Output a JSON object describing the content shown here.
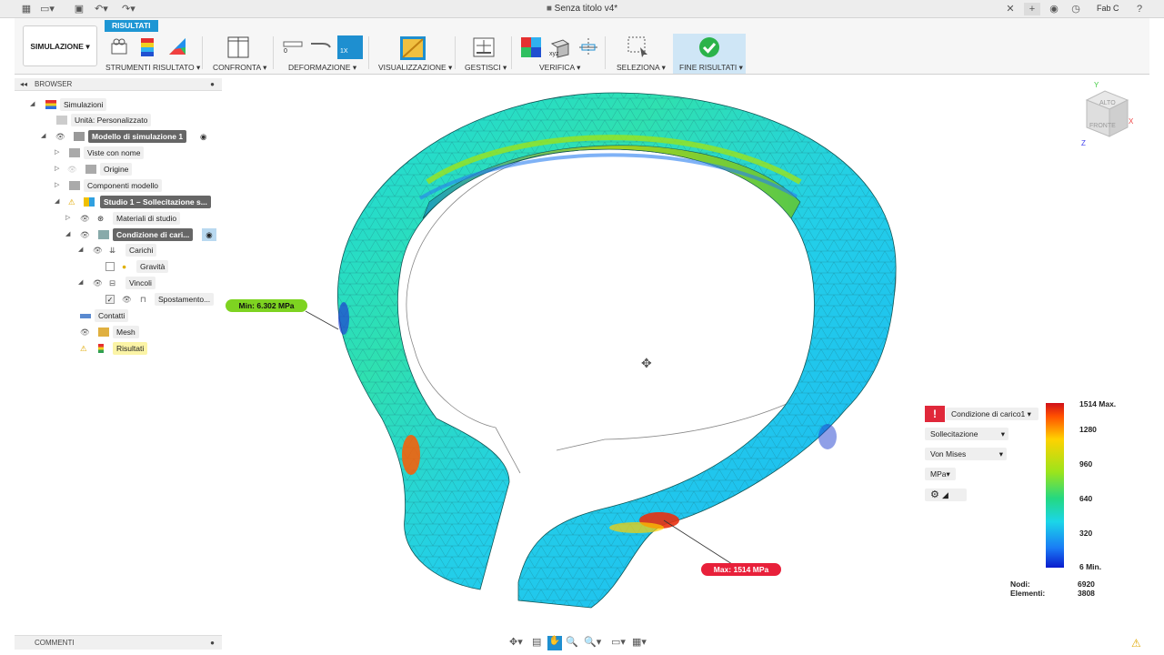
{
  "titlebar": {
    "title": "Senza titolo v4*",
    "user": "Fab C",
    "icons": [
      "grid-icon",
      "file-icon",
      "save-icon",
      "undo-icon",
      "redo-icon",
      "close-icon",
      "plus-icon",
      "job-status-icon",
      "clock-icon",
      "help-icon"
    ]
  },
  "ribbon": {
    "active_tab": "RISULTATI",
    "workspace": "SIMULAZIONE",
    "groups": {
      "strumenti": "STRUMENTI RISULTATO",
      "confronta": "CONFRONTA",
      "deformazione": "DEFORMAZIONE",
      "visualizzazione": "VISUALIZZAZIONE",
      "gestisci": "GESTISCI",
      "verifica": "VERIFICA",
      "seleziona": "SELEZIONA",
      "fine": "FINE RISULTATI"
    },
    "deform_value": "0",
    "deform_scale": "1X",
    "verifica_xyz": "xyz"
  },
  "browser": {
    "header": "BROWSER",
    "nodes": {
      "simulazioni": "Simulazioni",
      "unita": "Unità: Personalizzato",
      "modello": "Modello di simulazione 1",
      "viste": "Viste con nome",
      "origine": "Origine",
      "componenti": "Componenti modello",
      "studio": "Studio 1 – Sollecitazione s...",
      "materiali": "Materiali di studio",
      "condizione": "Condizione di cari...",
      "carichi": "Carichi",
      "gravita": "Gravità",
      "vincoli": "Vincoli",
      "spostamento": "Spostamento...",
      "contatti": "Contatti",
      "mesh": "Mesh",
      "risultati": "Risultati"
    }
  },
  "comments": "COMMENTI",
  "viewcube": {
    "top": "ALTO",
    "front": "FRONTE",
    "axis_x": "X",
    "axis_y": "Y",
    "axis_z": "Z"
  },
  "callouts": {
    "min": "Min: 6.302 MPa",
    "max": "Max: 1514 MPa"
  },
  "results_panel": {
    "load_case": "Condizione di carico1",
    "result_type": "Sollecitazione",
    "component": "Von Mises",
    "unit": "MPa"
  },
  "legend": {
    "max_label": "1514 Max.",
    "ticks": [
      "1280",
      "960",
      "640",
      "320"
    ],
    "min_label": "6 Min.",
    "max_value": 1514,
    "min_value": 6
  },
  "stats": {
    "nodes_label": "Nodi:",
    "nodes_value": "6920",
    "elements_label": "Elementi:",
    "elements_value": "3808"
  },
  "colors": {
    "accent": "#1e96d4",
    "min_callout": "#7ed321",
    "max_callout": "#e8203a",
    "fine_bg": "#cfe6f6",
    "check": "#2bb34a"
  }
}
